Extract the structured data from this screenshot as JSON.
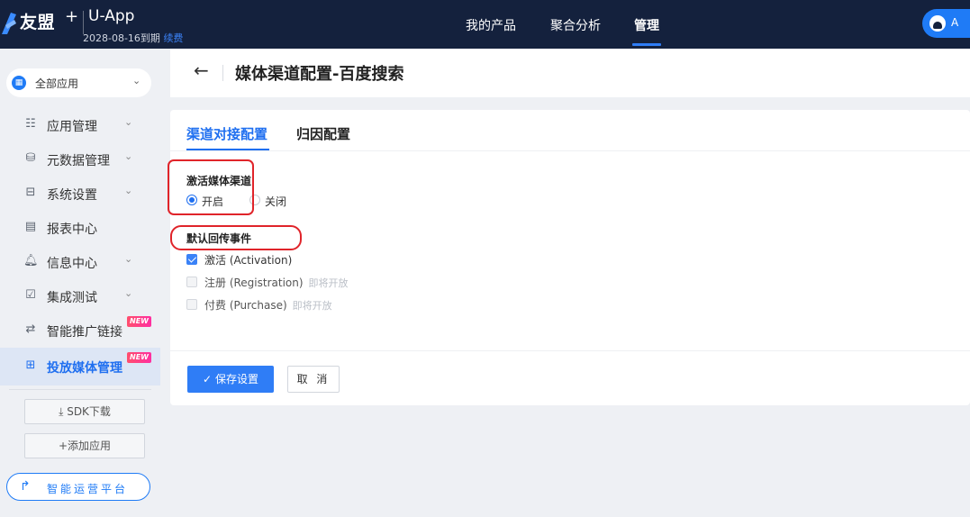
{
  "topbar": {
    "brand": "友盟",
    "brand_plus": "+",
    "app_name": "U-App",
    "expire_text": "2028-08-16到期",
    "renew_label": "续费",
    "nav": [
      "我的产品",
      "聚合分析",
      "管理"
    ],
    "active_nav": "管理",
    "avatar_text": "A"
  },
  "sidebar": {
    "all_apps_label": "全部应用",
    "items": [
      {
        "label": "应用管理",
        "icon": "grid-list-icon",
        "expandable": true
      },
      {
        "label": "元数据管理",
        "icon": "database-icon",
        "expandable": true
      },
      {
        "label": "系统设置",
        "icon": "settings-panel-icon",
        "expandable": true
      },
      {
        "label": "报表中心",
        "icon": "report-icon",
        "expandable": false
      },
      {
        "label": "信息中心",
        "icon": "bell-icon",
        "expandable": true
      },
      {
        "label": "集成测试",
        "icon": "monitor-check-icon",
        "expandable": true
      },
      {
        "label": "智能推广链接",
        "icon": "link-icon",
        "badge": "NEW"
      },
      {
        "label": "投放媒体管理",
        "icon": "media-icon",
        "badge": "NEW",
        "active": true
      }
    ],
    "sdk_download": "SDK下载",
    "add_app": "+添加应用",
    "ops_platform": "智能运营平台"
  },
  "page": {
    "title": "媒体渠道配置-百度搜索"
  },
  "card": {
    "tabs": [
      "渠道对接配置",
      "归因配置"
    ],
    "active_tab": "渠道对接配置",
    "activation_section": "激活媒体渠道",
    "radio_on": "开启",
    "radio_off": "关闭",
    "events_section": "默认回传事件",
    "events": [
      {
        "label": "激活 (Activation)",
        "checked": true,
        "hint": ""
      },
      {
        "label": "注册 (Registration)",
        "checked": false,
        "hint": "即将开放"
      },
      {
        "label": "付费 (Purchase)",
        "checked": false,
        "hint": "即将开放"
      }
    ],
    "save_label": "保存设置",
    "cancel_label": "取 消"
  },
  "colors": {
    "topbar": "#14213d",
    "accent": "#1f6ff0",
    "highlight": "#e0242a"
  }
}
